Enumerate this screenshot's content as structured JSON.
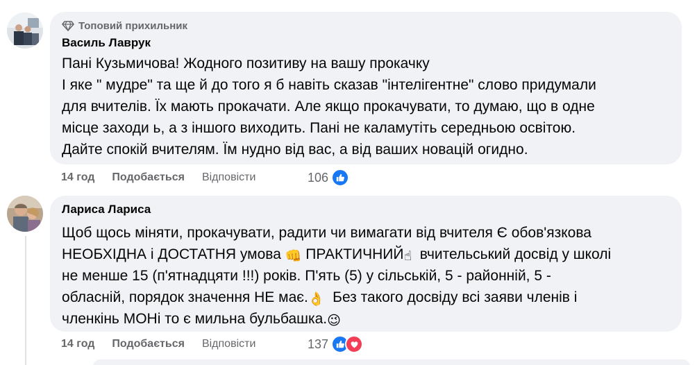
{
  "comments": [
    {
      "badge": "Топовий прихильник",
      "author": "Василь Лаврук",
      "lines": [
        "Пані Кузьмичова! Жодного позитиву на вашу прокачку",
        "І яке \" мудре\" та ще й до того я б навіть сказав \"інтелігентне\" слово придумали",
        "для вчителів. Їх мають прокачати. Але якщо прокачувати, то думаю, що в одне",
        "місце заходи ь, а з іншого виходить. Пані не каламутіть середньою освітою.",
        "Дайте спокій вчителям. Їм нудно від вас, а від ваших новацій огидно."
      ],
      "time": "14 год",
      "like_label": "Подобається",
      "reply_label": "Відповісти",
      "reaction_count": "106"
    },
    {
      "author": "Лариса Лариса",
      "line1": "Щоб щось міняти, прокачувати, радити чи вимагати від вчителя Є обов'язкова",
      "line2a": "НЕОБХІДНА і ДОСТАТНЯ умова",
      "line2b": "ПРАКТИЧНИЙ",
      "line2c": "вчительський досвід у школі",
      "line3": "не менше 15 (п'ятнадцяти !!!) років. П'ять (5) у сільській, 5 - районній, 5 -",
      "line4a": "обласній, порядок значення НЕ має.",
      "line4b": "Без такого досвіду всі заяви членів і",
      "line5": "членкінь МОНі то є мильна бульбашка.",
      "emoji_fist": "👊",
      "emoji_point": "☝",
      "emoji_ok": "👌",
      "emoji_smile": "😉",
      "time": "14 год",
      "like_label": "Подобається",
      "reply_label": "Відповісти",
      "reaction_count": "137"
    }
  ],
  "icons": {
    "badge": "diamond-icon",
    "like": "thumbs-up-icon",
    "love": "heart-icon"
  },
  "colors": {
    "bubble": "#f0f2f5",
    "secondary_text": "#65676b",
    "like_blue": "#1877f2",
    "love_red": "#f33e58"
  }
}
